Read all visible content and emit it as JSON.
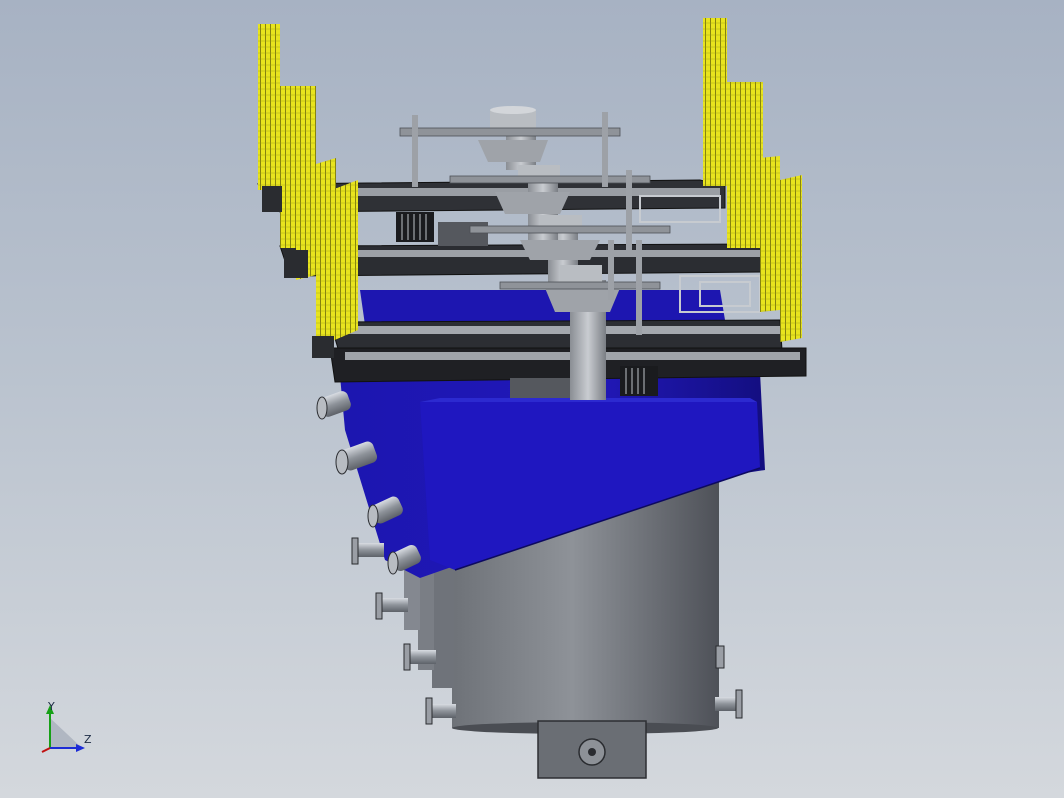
{
  "viewport": {
    "background_top": "#a7b2c3",
    "background_bottom": "#d4d8dd"
  },
  "model": {
    "colors": {
      "vessel_blue": "#1a14a6",
      "shell_gray": "#7b7f86",
      "frame_dark": "#2a2c30",
      "heater_yellow": "#e6e21c",
      "metal_light": "#a9adb3"
    }
  },
  "triad": {
    "y_label": "Y",
    "z_label": "Z",
    "icon": "coordinate-triad-icon"
  }
}
